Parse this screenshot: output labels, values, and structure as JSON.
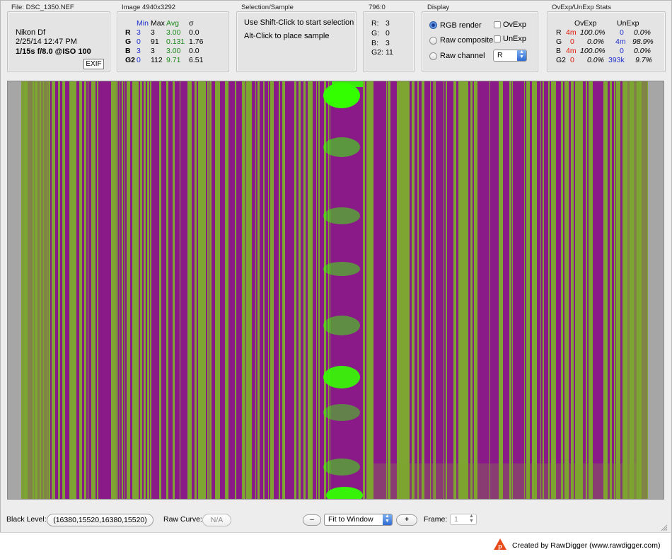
{
  "file_panel": {
    "title": "File: DSC_1350.NEF",
    "camera": "Nikon Df",
    "date": "2/25/14 12:47 PM",
    "exposure": "1/15s f/8.0 @ISO 100",
    "exif_button": "EXIF"
  },
  "image_panel": {
    "title": "Image 4940x3292",
    "headers": {
      "min": "Min",
      "max": "Max",
      "avg": "Avg",
      "sigma": "σ"
    },
    "rows": [
      {
        "ch": "R",
        "min": "3",
        "max": "3",
        "avg": "3.00",
        "sigma": "0.0"
      },
      {
        "ch": "G",
        "min": "0",
        "max": "91",
        "avg": "0.131",
        "sigma": "1.76"
      },
      {
        "ch": "B",
        "min": "3",
        "max": "3",
        "avg": "3.00",
        "sigma": "0.0"
      },
      {
        "ch": "G2",
        "min": "0",
        "max": "112",
        "avg": "9.71",
        "sigma": "6.51"
      }
    ]
  },
  "selection_panel": {
    "title": "Selection/Sample",
    "line1": "Use Shift-Click to start selection",
    "line2": "Alt-Click to place sample"
  },
  "sample_panel": {
    "title": "796:0",
    "rows": [
      {
        "label": "R:",
        "value": "3"
      },
      {
        "label": "G:",
        "value": "0"
      },
      {
        "label": "B:",
        "value": "3"
      },
      {
        "label": "G2:",
        "value": "11"
      }
    ]
  },
  "display_panel": {
    "title": "Display",
    "radios": [
      {
        "label": "RGB render",
        "selected": true
      },
      {
        "label": "Raw composite",
        "selected": false
      },
      {
        "label": "Raw channel",
        "selected": false
      }
    ],
    "checkboxes": [
      {
        "label": "OvExp",
        "checked": false
      },
      {
        "label": "UnExp",
        "checked": false
      }
    ],
    "channel_select": "R"
  },
  "stats_panel": {
    "title": "OvExp/UnExp Stats",
    "headers": {
      "ovexp": "OvExp",
      "unexp": "UnExp"
    },
    "rows": [
      {
        "ch": "R",
        "ov_count": "4m",
        "ov_pct": "100.0%",
        "un_count": "0",
        "un_pct": "0.0%"
      },
      {
        "ch": "G",
        "ov_count": "0",
        "ov_pct": "0.0%",
        "un_count": "4m",
        "un_pct": "98.9%"
      },
      {
        "ch": "B",
        "ov_count": "4m",
        "ov_pct": "100.0%",
        "un_count": "0",
        "un_pct": "0.0%"
      },
      {
        "ch": "G2",
        "ov_count": "0",
        "ov_pct": "0.0%",
        "un_count": "393k",
        "un_pct": "9.7%"
      }
    ]
  },
  "bottom_bar": {
    "black_level_label": "Black Level:",
    "black_level_value": "(16380,15520,16380,15520)",
    "raw_curve_label": "Raw Curve:",
    "raw_curve_value": "N/A",
    "zoom_out": "–",
    "zoom_select": "Fit to Window",
    "zoom_in": "+",
    "frame_label": "Frame:",
    "frame_value": "1"
  },
  "footer": {
    "credit": "Created by RawDigger (www.rawdigger.com)"
  },
  "colors": {
    "image_green": "#7ea531",
    "image_purple": "#8b1a89",
    "image_bright_green": "#33ff00"
  }
}
